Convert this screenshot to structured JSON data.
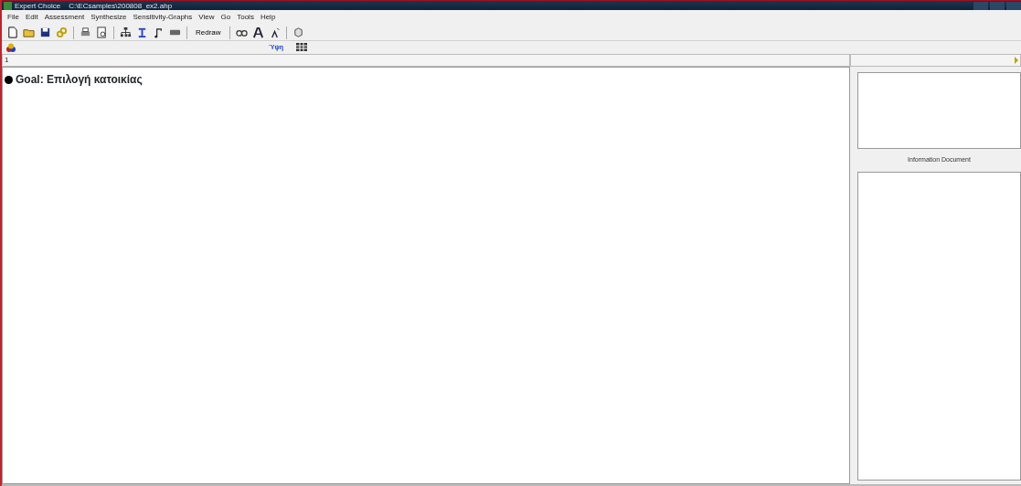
{
  "window": {
    "title": "Expert Choice    C:\\ECsamples\\200808_ex2.ahp"
  },
  "menu": [
    "File",
    "Edit",
    "Assessment",
    "Synthesize",
    "Sensitivity-Graphs",
    "View",
    "Go",
    "Tools",
    "Help"
  ],
  "toolbar": [
    {
      "kind": "icon"
    },
    {
      "kind": "icon"
    },
    {
      "kind": "icon"
    },
    {
      "kind": "icon"
    },
    {
      "kind": "sep"
    },
    {
      "kind": "icon"
    },
    {
      "kind": "icon"
    },
    {
      "kind": "sep"
    },
    {
      "kind": "icon"
    },
    {
      "kind": "icon"
    },
    {
      "kind": "icon"
    },
    {
      "kind": "icon"
    },
    {
      "kind": "sep"
    },
    {
      "kind": "text",
      "label": "Redraw"
    },
    {
      "kind": "sep"
    },
    {
      "kind": "icon"
    },
    {
      "kind": "icon"
    },
    {
      "kind": "icon"
    },
    {
      "kind": "sep"
    },
    {
      "kind": "icon"
    }
  ],
  "toolbar2": {
    "tab_label": "Ύψη"
  },
  "tree_header": "1",
  "goal": "Goal: Επιλογή κατοικίας",
  "info_panel": {
    "label": "Information Document"
  }
}
